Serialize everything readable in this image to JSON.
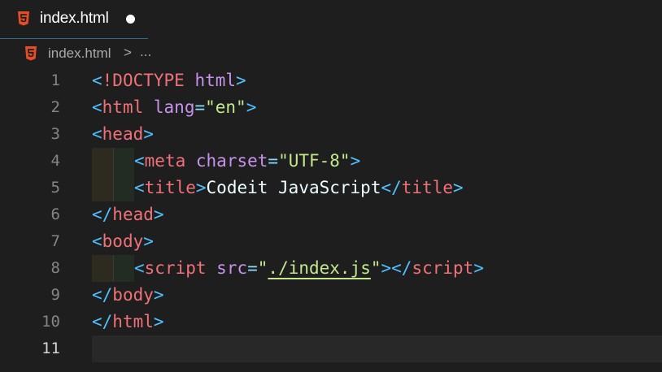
{
  "tab": {
    "label": "index.html",
    "icon": "html5-icon",
    "dirty": true
  },
  "breadcrumb": {
    "file": "index.html",
    "separator": ">",
    "more": "..."
  },
  "colors": {
    "background": "#1e1e1e",
    "tag": "#f07178",
    "punctuation": "#4fc1ff",
    "attribute": "#c792ea",
    "string": "#c3e88d",
    "line_number": "#858585",
    "html5_icon": "#e44d26"
  },
  "editor": {
    "current_line": 11,
    "lines": [
      {
        "n": "1",
        "indent": 0,
        "tokens": [
          [
            "punct",
            "<"
          ],
          [
            "doct",
            "!DOCTYPE"
          ],
          [
            "text",
            " "
          ],
          [
            "attr",
            "html"
          ],
          [
            "punct",
            ">"
          ]
        ]
      },
      {
        "n": "2",
        "indent": 0,
        "tokens": [
          [
            "punct",
            "<"
          ],
          [
            "tag",
            "html"
          ],
          [
            "text",
            " "
          ],
          [
            "attr",
            "lang"
          ],
          [
            "eq",
            "="
          ],
          [
            "str",
            "\"en\""
          ],
          [
            "punct",
            ">"
          ]
        ]
      },
      {
        "n": "3",
        "indent": 0,
        "tokens": [
          [
            "punct",
            "<"
          ],
          [
            "tag",
            "head"
          ],
          [
            "punct",
            ">"
          ]
        ]
      },
      {
        "n": "4",
        "indent": 1,
        "tokens": [
          [
            "punct",
            "<"
          ],
          [
            "tag",
            "meta"
          ],
          [
            "text",
            " "
          ],
          [
            "attr",
            "charset"
          ],
          [
            "eq",
            "="
          ],
          [
            "str",
            "\"UTF-8\""
          ],
          [
            "punct",
            ">"
          ]
        ]
      },
      {
        "n": "5",
        "indent": 1,
        "tokens": [
          [
            "punct",
            "<"
          ],
          [
            "tag",
            "title"
          ],
          [
            "punct",
            ">"
          ],
          [
            "text",
            "Codeit JavaScript"
          ],
          [
            "punct",
            "</"
          ],
          [
            "tag",
            "title"
          ],
          [
            "punct",
            ">"
          ]
        ]
      },
      {
        "n": "6",
        "indent": 0,
        "tokens": [
          [
            "punct",
            "</"
          ],
          [
            "tag",
            "head"
          ],
          [
            "punct",
            ">"
          ]
        ]
      },
      {
        "n": "7",
        "indent": 0,
        "tokens": [
          [
            "punct",
            "<"
          ],
          [
            "tag",
            "body"
          ],
          [
            "punct",
            ">"
          ]
        ]
      },
      {
        "n": "8",
        "indent": 1,
        "tokens": [
          [
            "punct",
            "<"
          ],
          [
            "tag",
            "script"
          ],
          [
            "text",
            " "
          ],
          [
            "attr",
            "src"
          ],
          [
            "eq",
            "="
          ],
          [
            "str",
            "\""
          ],
          [
            "strsq",
            "./index.js"
          ],
          [
            "str",
            "\""
          ],
          [
            "punct",
            "></"
          ],
          [
            "tag",
            "script"
          ],
          [
            "punct",
            ">"
          ]
        ]
      },
      {
        "n": "9",
        "indent": 0,
        "tokens": [
          [
            "punct",
            "</"
          ],
          [
            "tag",
            "body"
          ],
          [
            "punct",
            ">"
          ]
        ]
      },
      {
        "n": "10",
        "indent": 0,
        "tokens": [
          [
            "punct",
            "</"
          ],
          [
            "tag",
            "html"
          ],
          [
            "punct",
            ">"
          ]
        ]
      },
      {
        "n": "11",
        "indent": 0,
        "tokens": []
      }
    ]
  }
}
